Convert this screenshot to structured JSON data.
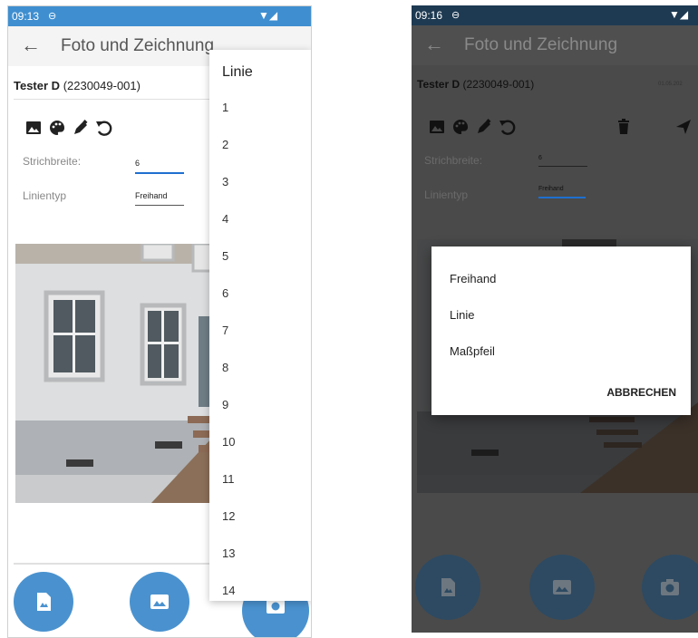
{
  "left": {
    "status": {
      "time": "09:13"
    },
    "appbar": {
      "title": "Foto und Zeichnung"
    },
    "tester": {
      "name": "Tester D",
      "id": "(2230049-001)"
    },
    "fields": {
      "strichbreite_label": "Strichbreite:",
      "strichbreite_value": "6",
      "linientyp_label": "Linientyp",
      "linientyp_value": "Freihand"
    },
    "dropdown": {
      "title": "Linie",
      "items": [
        "1",
        "2",
        "3",
        "4",
        "5",
        "6",
        "7",
        "8",
        "9",
        "10",
        "11",
        "12",
        "13",
        "14"
      ]
    }
  },
  "right": {
    "status": {
      "time": "09:16"
    },
    "appbar": {
      "title": "Foto und Zeichnung"
    },
    "tester": {
      "name": "Tester D",
      "id": "(2230049-001)",
      "date": "01.05.202"
    },
    "fields": {
      "strichbreite_label": "Strichbreite:",
      "strichbreite_value": "6",
      "linientyp_label": "Linientyp",
      "linientyp_value": "Freihand"
    },
    "dialog": {
      "options": [
        "Freihand",
        "Linie",
        "Maßpfeil"
      ],
      "cancel": "ABBRECHEN"
    }
  },
  "colors": {
    "status_left": "#3f8fd0",
    "status_right": "#1e3a52",
    "fab": "#4a92cf",
    "underline": "#1e6fd0"
  },
  "icons": [
    "image-icon",
    "palette-icon",
    "pen-icon",
    "undo-icon",
    "trash-icon",
    "send-icon",
    "document-image-icon",
    "camera-icon"
  ]
}
